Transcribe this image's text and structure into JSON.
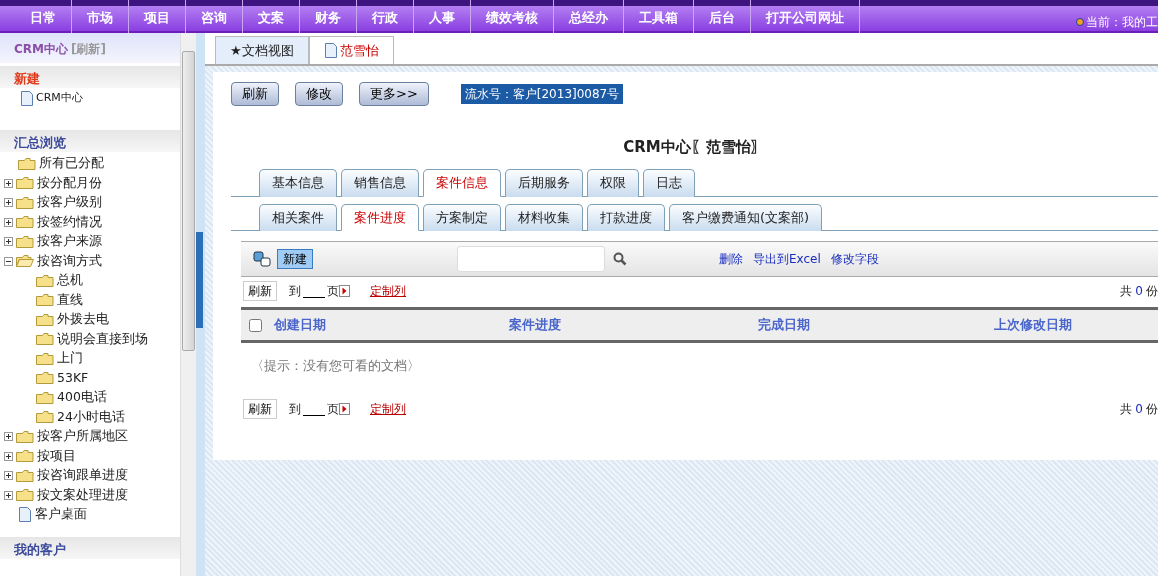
{
  "topnav": {
    "items": [
      {
        "label": "日常"
      },
      {
        "label": "市场"
      },
      {
        "label": "项目"
      },
      {
        "label": "咨询"
      },
      {
        "label": "文案"
      },
      {
        "label": "财务"
      },
      {
        "label": "行政"
      },
      {
        "label": "人事"
      },
      {
        "label": "绩效考核"
      },
      {
        "label": "总经办"
      },
      {
        "label": "工具箱"
      },
      {
        "label": "后台"
      },
      {
        "label": "打开公司网址"
      }
    ],
    "current": "当前：我的工"
  },
  "sidebar": {
    "title": "CRM中心",
    "refresh": "[刷新]",
    "new_title": "新建",
    "new_items": [
      {
        "label": "CRM中心"
      }
    ],
    "browse_title": "汇总浏览",
    "tree": [
      {
        "label": "所有已分配",
        "kind": "folder"
      },
      {
        "label": "按分配月份",
        "kind": "group",
        "expanded": false
      },
      {
        "label": "按客户级别",
        "kind": "group",
        "expanded": false
      },
      {
        "label": "按签约情况",
        "kind": "group",
        "expanded": false
      },
      {
        "label": "按客户来源",
        "kind": "group",
        "expanded": false
      },
      {
        "label": "按咨询方式",
        "kind": "group",
        "expanded": true,
        "children": [
          {
            "label": "总机",
            "kind": "folder"
          },
          {
            "label": "直线",
            "kind": "folder"
          },
          {
            "label": "外拨去电",
            "kind": "folder"
          },
          {
            "label": "说明会直接到场",
            "kind": "folder"
          },
          {
            "label": "上门",
            "kind": "folder"
          },
          {
            "label": "53KF",
            "kind": "folder"
          },
          {
            "label": "400电话",
            "kind": "folder"
          },
          {
            "label": "24小时电话",
            "kind": "folder"
          }
        ]
      },
      {
        "label": "按客户所属地区",
        "kind": "group",
        "expanded": false
      },
      {
        "label": "按项目",
        "kind": "group",
        "expanded": false
      },
      {
        "label": "按咨询跟单进度",
        "kind": "group",
        "expanded": false
      },
      {
        "label": "按文案处理进度",
        "kind": "group",
        "expanded": false
      },
      {
        "label": "客户桌面",
        "kind": "page"
      }
    ],
    "my_title": "我的客户"
  },
  "doc_tabs": [
    {
      "label": "★文档视图",
      "selected": false,
      "kind": "view"
    },
    {
      "label": "范雪怡",
      "selected": true,
      "kind": "document"
    }
  ],
  "toolbar": {
    "buttons": [
      "刷新",
      "修改",
      "更多>>"
    ],
    "serial": "流水号：客户[2013]0087号"
  },
  "title": "CRM中心〖范雪怡〗",
  "main_tabs": [
    {
      "label": "基本信息",
      "selected": false
    },
    {
      "label": "销售信息",
      "selected": false
    },
    {
      "label": "案件信息",
      "selected": true
    },
    {
      "label": "后期服务",
      "selected": false
    },
    {
      "label": "权限",
      "selected": false
    },
    {
      "label": "日志",
      "selected": false
    }
  ],
  "sub_tabs": [
    {
      "label": "相关案件",
      "selected": false
    },
    {
      "label": "案件进度",
      "selected": true
    },
    {
      "label": "方案制定",
      "selected": false
    },
    {
      "label": "材料收集",
      "selected": false
    },
    {
      "label": "打款进度",
      "selected": false
    },
    {
      "label": "客户缴费通知(文案部)",
      "selected": false
    }
  ],
  "list_toolbar": {
    "new": "新建",
    "links": [
      "删除",
      "导出到Excel",
      "修改字段"
    ]
  },
  "pagers": [
    {
      "refresh": "刷新",
      "goto": "到",
      "page": "页",
      "custom": "定制列",
      "total_prefix": "共",
      "count": "0",
      "total_suffix": "份"
    },
    {
      "refresh": "刷新",
      "goto": "到",
      "page": "页",
      "custom": "定制列",
      "total_prefix": "共",
      "count": "0",
      "total_suffix": "份"
    }
  ],
  "table": {
    "columns": [
      "创建日期",
      "案件进度",
      "完成日期",
      "上次修改日期"
    ],
    "select_all": {
      "checked": false
    },
    "empty": "〈提示：没有您可看的文档〉"
  }
}
